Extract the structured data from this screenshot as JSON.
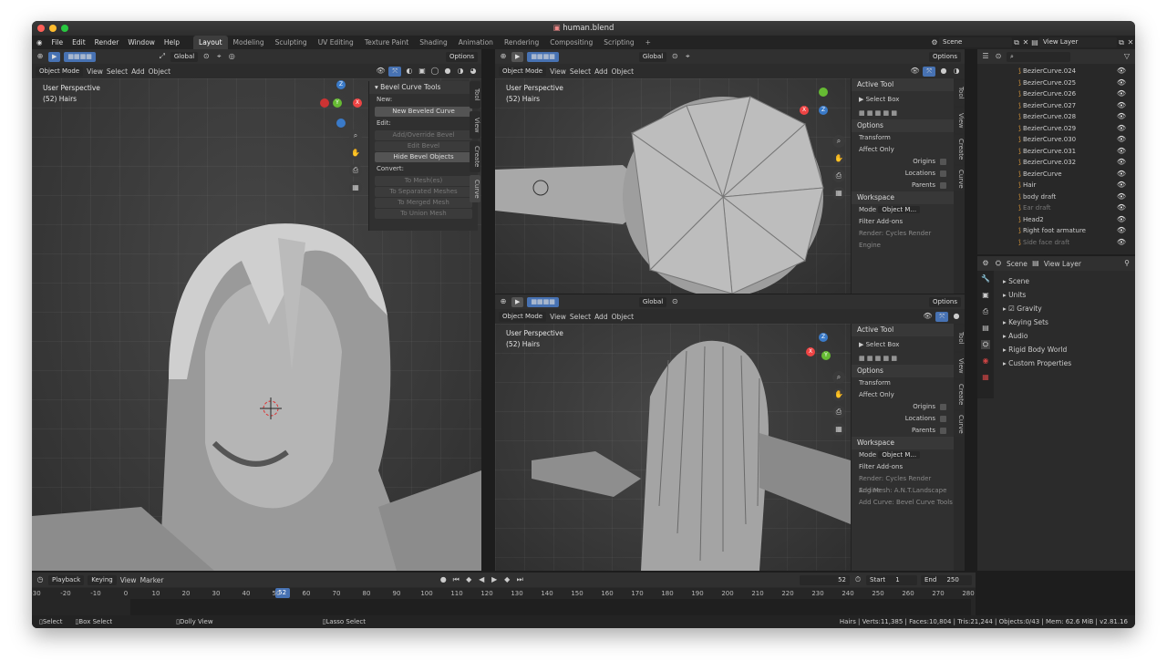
{
  "window": {
    "title": "human.blend"
  },
  "menu": [
    "File",
    "Edit",
    "Render",
    "Window",
    "Help"
  ],
  "workspaces": [
    "Layout",
    "Modeling",
    "Sculpting",
    "UV Editing",
    "Texture Paint",
    "Shading",
    "Animation",
    "Rendering",
    "Compositing",
    "Scripting"
  ],
  "active_workspace": "Layout",
  "scene": {
    "label": "Scene",
    "view_layer": "View Layer"
  },
  "toolbar": {
    "orientation": "Global",
    "options": "Options",
    "mode": "Object Mode",
    "view": "View",
    "select": "Select",
    "add": "Add",
    "object": "Object"
  },
  "viewport_left": {
    "perspective": "User Perspective",
    "object": "(52) Hairs"
  },
  "viewport_tr": {
    "perspective": "User Perspective",
    "object": "(52) Hairs"
  },
  "viewport_br": {
    "perspective": "User Perspective",
    "object": "(52) Hairs"
  },
  "bevel_panel": {
    "title": "Bevel Curve Tools",
    "new_label": "New:",
    "new_btn": "New Beveled Curve",
    "edit_label": "Edit:",
    "add_override": "Add/Override Bevel",
    "edit_bevel": "Edit Bevel",
    "hide_bevel": "Hide Bevel Objects",
    "convert_label": "Convert:",
    "to_meshes": "To Mesh(es)",
    "to_separated": "To Separated Meshes",
    "to_merged": "To Merged Mesh",
    "to_union": "To Union Mesh"
  },
  "side_tabs": {
    "tool": "Tool",
    "view": "View",
    "create": "Create",
    "curve": "Curve"
  },
  "tool_panel": {
    "active_tool": "Active Tool",
    "select_box": "Select Box",
    "options": "Options",
    "transform": "Transform",
    "affect_only": "Affect Only",
    "origins": "Origins",
    "locations": "Locations",
    "parents": "Parents",
    "workspace": "Workspace",
    "mode": "Mode",
    "mode_value": "Object M...",
    "filter_addons": "Filter Add-ons",
    "addons": [
      "Render: Cycles Render Engine",
      "Add Mesh: A.N.T.Landscape",
      "Add Curve: Bevel Curve Tools"
    ]
  },
  "outliner": {
    "items": [
      {
        "name": "BezierCurve.024",
        "dim": false
      },
      {
        "name": "BezierCurve.025",
        "dim": false
      },
      {
        "name": "BezierCurve.026",
        "dim": false
      },
      {
        "name": "BezierCurve.027",
        "dim": false
      },
      {
        "name": "BezierCurve.028",
        "dim": false
      },
      {
        "name": "BezierCurve.029",
        "dim": false
      },
      {
        "name": "BezierCurve.030",
        "dim": false
      },
      {
        "name": "BezierCurve.031",
        "dim": false
      },
      {
        "name": "BezierCurve.032",
        "dim": false
      },
      {
        "name": "BezierCurve",
        "dim": false
      },
      {
        "name": "Hair",
        "dim": false
      },
      {
        "name": "body draft",
        "dim": false
      },
      {
        "name": "Ear draft",
        "dim": true
      },
      {
        "name": "Head2",
        "dim": false
      },
      {
        "name": "Right foot armature",
        "dim": false
      },
      {
        "name": "Side face draft",
        "dim": true
      }
    ]
  },
  "properties": {
    "scene_tab": "Scene",
    "view_layer_tab": "View Layer",
    "sections": [
      "Scene",
      "Units",
      "Gravity",
      "Keying Sets",
      "Audio",
      "Rigid Body World",
      "Custom Properties"
    ]
  },
  "timeline": {
    "playback": "Playback",
    "keying": "Keying",
    "view": "View",
    "marker": "Marker",
    "current": "52",
    "start_label": "Start",
    "start": "1",
    "end_label": "End",
    "end": "250",
    "ticks": [
      "-30",
      "-20",
      "-10",
      "0",
      "10",
      "20",
      "30",
      "40",
      "50",
      "60",
      "70",
      "80",
      "90",
      "100",
      "110",
      "120",
      "130",
      "140",
      "150",
      "160",
      "170",
      "180",
      "190",
      "200",
      "210",
      "220",
      "230",
      "240",
      "250",
      "260",
      "270",
      "280"
    ]
  },
  "status": {
    "select": "Select",
    "box_select": "Box Select",
    "dolly": "Dolly View",
    "lasso": "Lasso Select",
    "stats": "Hairs | Verts:11,385 | Faces:10,804 | Tris:21,244 | Objects:0/43 | Mem: 62.6 MiB | v2.81.16"
  }
}
